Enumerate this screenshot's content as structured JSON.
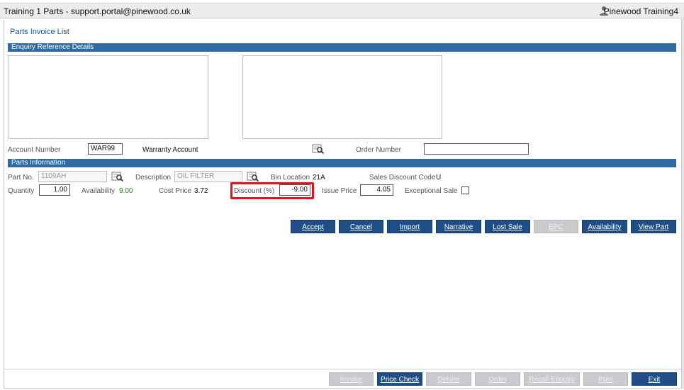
{
  "window": {
    "title": "Training 1 Parts - support.portal@pinewood.co.uk",
    "user": "Pinewood Training4"
  },
  "breadcrumb": "Parts Invoice List",
  "enquiry": {
    "section_title": "Enquiry Reference Details",
    "account_number_label": "Account Number",
    "account_number_value": "WAR99",
    "account_name": "Warranty Account",
    "order_number_label": "Order Number",
    "order_number_value": ""
  },
  "parts": {
    "section_title": "Parts Information",
    "part_no_label": "Part No.",
    "part_no_value": "1109AH",
    "description_label": "Description",
    "description_value": "OIL FILTER",
    "bin_location_label": "Bin Location",
    "bin_location_value": "21A",
    "sales_discount_code_label": "Sales Discount Code",
    "sales_discount_code_value": "U",
    "quantity_label": "Quantity",
    "quantity_value": "1.00",
    "availability_label": "Availability",
    "availability_value": "9.00",
    "cost_price_label": "Cost Price",
    "cost_price_value": "3.72",
    "discount_label": "Discount (%)",
    "discount_value": "-9.00",
    "issue_price_label": "Issue Price",
    "issue_price_value": "4.05",
    "exceptional_sale_label": "Exceptional Sale",
    "exceptional_sale_checked": false
  },
  "action_buttons": [
    {
      "label": "Accept",
      "enabled": true
    },
    {
      "label": "Cancel",
      "enabled": true
    },
    {
      "label": "Import",
      "enabled": true
    },
    {
      "label": "Narrative",
      "enabled": true
    },
    {
      "label": "Lost Sale",
      "enabled": true
    },
    {
      "label": "EPC",
      "enabled": false
    },
    {
      "label": "Availability",
      "enabled": true
    },
    {
      "label": "View Part",
      "enabled": true
    }
  ],
  "footer_buttons": [
    {
      "label": "Invoice",
      "enabled": false
    },
    {
      "label": "Price Check",
      "enabled": true
    },
    {
      "label": "Deliver",
      "enabled": false
    },
    {
      "label": "Order",
      "enabled": false
    },
    {
      "label": "Recall Enquiry",
      "enabled": false
    },
    {
      "label": "Print",
      "enabled": false
    },
    {
      "label": "Exit",
      "enabled": true
    }
  ],
  "colors": {
    "section_header": "#2f6aa3",
    "button": "#1f4e86",
    "button_disabled": "#c9cbcf",
    "highlight": "#e8101a",
    "availability": "#2a7a1a"
  }
}
